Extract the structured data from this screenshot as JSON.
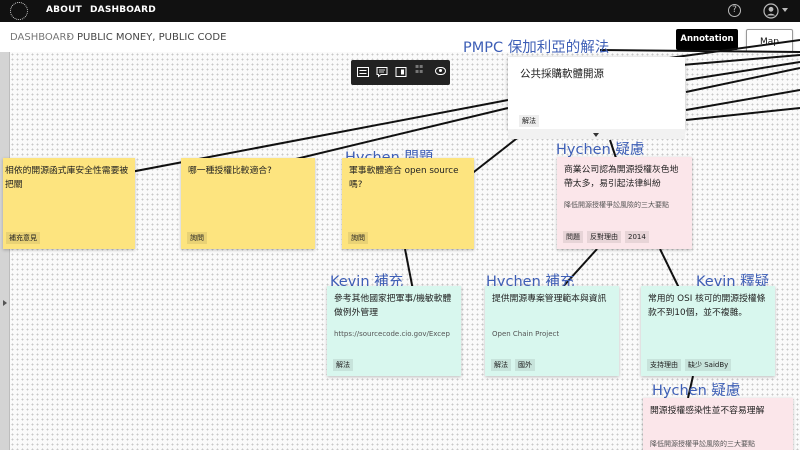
{
  "nav": {
    "about": "ABOUT",
    "dashboard": "DASHBOARD"
  },
  "breadcrumb": {
    "root": "DASHBOARD",
    "current": "PUBLIC MONEY, PUBLIC CODE"
  },
  "buttons": {
    "annotation": "Annotation",
    "map": "Map"
  },
  "root_card": {
    "heading": "PMPC 保加利亞的解法",
    "title": "公共採購軟體開源",
    "tag": "解法"
  },
  "cards": {
    "card_left": {
      "title": "相依的開源函式庫安全性需要被把關",
      "tag": "補充意見"
    },
    "card_license": {
      "title": "哪一種授權比較適合?",
      "tag": "詢問"
    },
    "card_military": {
      "annotation": "Hychen 問題",
      "title": "軍事軟體適合 open source 嗎?",
      "tag": "詢問"
    },
    "card_commercial": {
      "annotation": "Hychen 疑慮",
      "title": "商業公司認為開源授權灰色地帶太多，易引起法律糾紛",
      "sub": "降低開源授權爭訟風險的三大要點",
      "tags": [
        "問題",
        "反對理由",
        "2014"
      ]
    },
    "card_reference": {
      "annotation": "Kevin 補充",
      "title": "參考其他國家把軍事/機敏軟體做例外管理",
      "sub": "https://sourcecode.cio.gov/Excep",
      "tag": "解法"
    },
    "card_provide": {
      "annotation": "Hychen 補充",
      "title": "提供開源專案管理範本與資訊",
      "sub": "Open Chain Project",
      "tags": [
        "解法",
        "國外"
      ]
    },
    "card_osi": {
      "annotation": "Kevin 釋疑",
      "title": "常用的 OSI 核可的開源授權條款不到10個，並不複雜。",
      "tags": [
        "支持理由",
        "缺少 SaidBy"
      ]
    },
    "card_infect": {
      "annotation": "Hychen 疑慮",
      "title": "開源授權感染性並不容易理解",
      "sub": "降低開源授權爭訟風險的三大要點"
    }
  },
  "colors": {
    "topbar": "#111111",
    "yellow_card": "#fde47f",
    "pink_card": "#fbe6ea",
    "mint_card": "#d8f7ee",
    "annotation_ink": "#3e5fb6"
  },
  "icons": [
    "logo-icon",
    "help-icon",
    "user-icon",
    "list-view-icon",
    "comment-icon",
    "export-icon",
    "grid-icon",
    "eye-icon",
    "collapse-arrow-icon"
  ]
}
